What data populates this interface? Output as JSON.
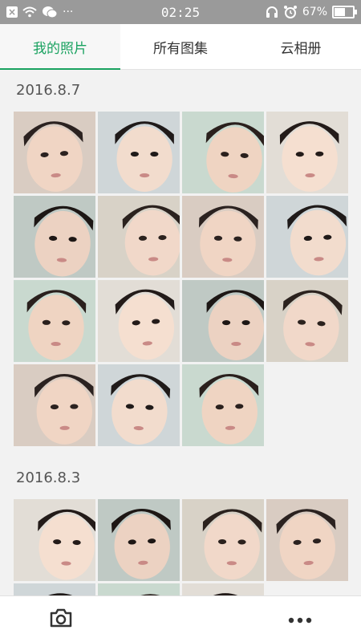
{
  "status_bar": {
    "time": "02:25",
    "dots": "···",
    "battery": "67%",
    "battery_level": 0.67
  },
  "tabs": [
    {
      "label": "我的照片"
    },
    {
      "label": "所有图集"
    },
    {
      "label": "云相册"
    }
  ],
  "sections": [
    {
      "date": "2016.8.7",
      "photo_count": 15
    },
    {
      "date": "2016.8.3",
      "photo_count": 7
    }
  ],
  "icons": {
    "camera": "camera-icon",
    "more": "more-icon"
  },
  "colors": {
    "accent": "#1aa260",
    "status_bar": "#9a9a9a"
  }
}
